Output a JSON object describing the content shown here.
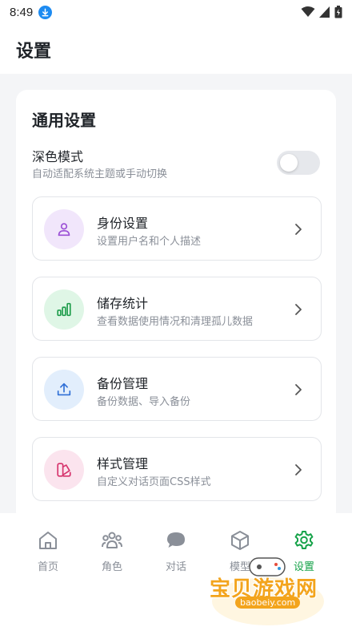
{
  "status_bar": {
    "time": "8:49"
  },
  "header": {
    "title": "设置"
  },
  "general": {
    "title": "通用设置",
    "dark_mode": {
      "title": "深色模式",
      "subtitle": "自动适配系统主题或手动切换",
      "enabled": false
    }
  },
  "items": [
    {
      "title": "身份设置",
      "subtitle": "设置用户名和个人描述",
      "icon": "user-icon",
      "icon_bg": "#f1e6fb",
      "icon_color": "#9b4fd6"
    },
    {
      "title": "储存统计",
      "subtitle": "查看数据使用情况和清理孤儿数据",
      "icon": "bar-chart-icon",
      "icon_bg": "#dff6e6",
      "icon_color": "#1f9d4c"
    },
    {
      "title": "备份管理",
      "subtitle": "备份数据、导入备份",
      "icon": "upload-icon",
      "icon_bg": "#e2eefc",
      "icon_color": "#2f6fd6"
    },
    {
      "title": "样式管理",
      "subtitle": "自定义对话页面CSS样式",
      "icon": "palette-icon",
      "icon_bg": "#fbe4ee",
      "icon_color": "#d6336c"
    }
  ],
  "nav": [
    {
      "label": "首页",
      "icon": "home-icon",
      "active": false
    },
    {
      "label": "角色",
      "icon": "people-icon",
      "active": false
    },
    {
      "label": "对话",
      "icon": "chat-icon",
      "active": false
    },
    {
      "label": "模型",
      "icon": "cube-icon",
      "active": false
    },
    {
      "label": "设置",
      "icon": "gear-icon",
      "active": true
    }
  ],
  "watermark": {
    "text": "宝贝游戏网",
    "url": "baobeiy.com"
  },
  "colors": {
    "accent": "#17a34a",
    "muted": "#8a8f98"
  }
}
